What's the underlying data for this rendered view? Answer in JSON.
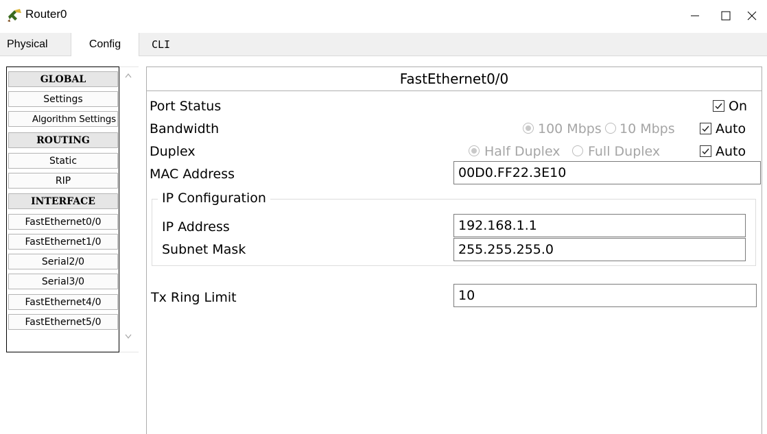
{
  "window": {
    "title": "Router0",
    "icon": "router-icon",
    "controls": [
      "minimize-icon",
      "maximize-icon",
      "close-icon"
    ]
  },
  "tabs": [
    {
      "label": "Physical",
      "active": false
    },
    {
      "label": "Config",
      "active": true
    },
    {
      "label": "CLI",
      "active": false
    }
  ],
  "nav": {
    "items": [
      {
        "label": "GLOBAL",
        "type": "header"
      },
      {
        "label": "Settings",
        "type": "item"
      },
      {
        "label": "Algorithm Settings",
        "type": "item"
      },
      {
        "label": "ROUTING",
        "type": "header"
      },
      {
        "label": "Static",
        "type": "item"
      },
      {
        "label": "RIP",
        "type": "item"
      },
      {
        "label": "INTERFACE",
        "type": "header"
      },
      {
        "label": "FastEthernet0/0",
        "type": "item"
      },
      {
        "label": "FastEthernet1/0",
        "type": "item"
      },
      {
        "label": "Serial2/0",
        "type": "item"
      },
      {
        "label": "Serial3/0",
        "type": "item"
      },
      {
        "label": "FastEthernet4/0",
        "type": "item"
      },
      {
        "label": "FastEthernet5/0",
        "type": "item"
      }
    ]
  },
  "interface": {
    "title": "FastEthernet0/0",
    "port_status": {
      "label": "Port Status",
      "on_label": "On",
      "on_checked": true
    },
    "bandwidth": {
      "label": "Bandwidth",
      "opt1": "100 Mbps",
      "opt2": "10 Mbps",
      "auto_label": "Auto",
      "auto_checked": true,
      "selected": "100 Mbps"
    },
    "duplex": {
      "label": "Duplex",
      "opt1": "Half Duplex",
      "opt2": "Full Duplex",
      "auto_label": "Auto",
      "auto_checked": true,
      "selected": "Half Duplex"
    },
    "mac": {
      "label": "MAC Address",
      "value": "00D0.FF22.3E10"
    },
    "ip_config": {
      "title": "IP Configuration",
      "ip": {
        "label": "IP Address",
        "value": "192.168.1.1"
      },
      "mask": {
        "label": "Subnet Mask",
        "value": "255.255.255.0"
      }
    },
    "tx_ring": {
      "label": "Tx Ring Limit",
      "value": "10"
    }
  }
}
